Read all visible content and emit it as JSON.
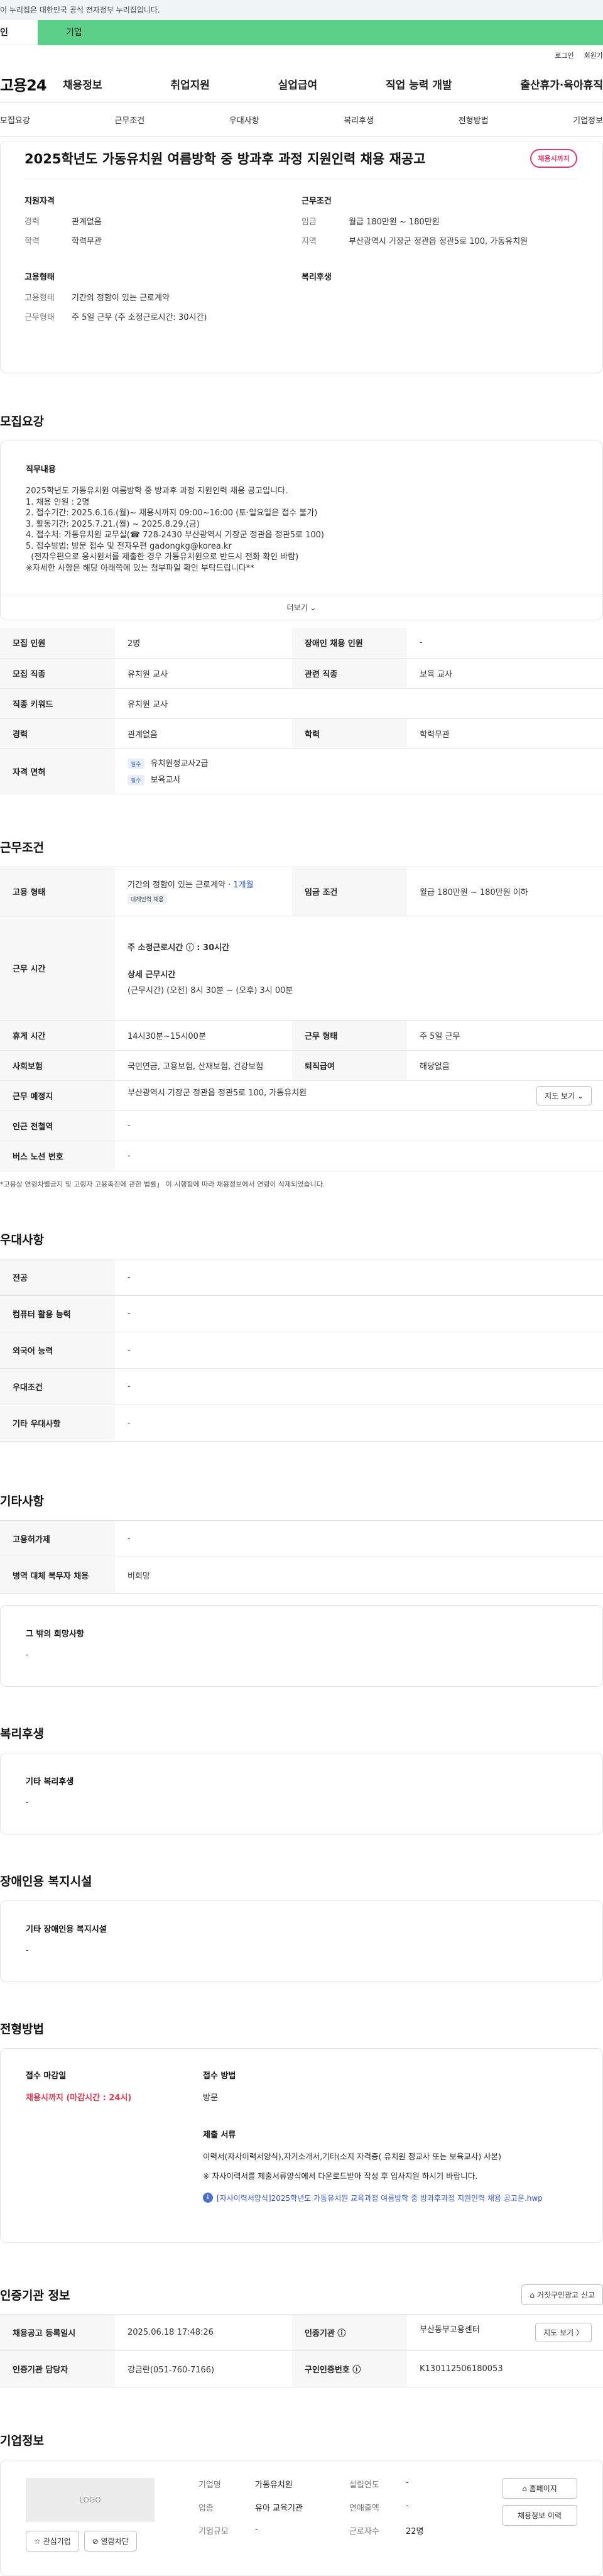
{
  "notice": {
    "text": "이 누리집은 대한민국 공식 전자정부 누리집입니다."
  },
  "member": {
    "personal": "인",
    "company": "기업"
  },
  "util": {
    "login": "로그인",
    "join": "회원가"
  },
  "gnb": {
    "logo": "고용24",
    "menu": [
      "채용정보",
      "취업지원",
      "실업급여",
      "직업 능력 개발",
      "출산휴가·육아휴직"
    ]
  },
  "tabs": [
    "모집요강",
    "근무조건",
    "우대사항",
    "복리후생",
    "전형방법",
    "기업정보"
  ],
  "summary": {
    "title": "2025학년도 가동유치원 여름방학 중 방과후 과정 지원인력 채용 재공고",
    "badge": "채용시까지",
    "qual_h": "지원자격",
    "cond_h": "근무조건",
    "emp_h": "고용형태",
    "welfare_h": "복리후생",
    "qual": [
      {
        "k": "경력",
        "v": "관계없음"
      },
      {
        "k": "학력",
        "v": "학력무관"
      }
    ],
    "cond": [
      {
        "k": "임금",
        "v": "월급 180만원 ~ 180만원"
      },
      {
        "k": "지역",
        "v": "부산광역시 기장군 정관읍 정관5로 100, 가동유치원"
      }
    ],
    "emp": [
      {
        "k": "고용형태",
        "v": "기간의 정함이 있는 근로계약"
      },
      {
        "k": "근무형태",
        "v": "주 5일 근무 (주 소정근로시간: 30시간)"
      }
    ]
  },
  "recruit": {
    "title": "모집요강",
    "h": "직무내용",
    "body": "2025학년도 가동유치원 여름방학 중 방과후 과정 지원인력 채용 공고입니다.\n1. 채용 인원 : 2명\n2. 접수기간: 2025.6.16.(월)~ 채용시까지 09:00~16:00 (토·일요일은 접수 불가)\n3. 활동기간: 2025.7.21.(월) ~ 2025.8.29.(금)\n4. 접수처: 가동유치원 교무실(☎ 728-2430 부산광역시 기장군 정관읍 정관5로 100)\n5. 접수방법: 방문 접수 및 전자우편 gadongkg@korea.kr\n  (전자우편으로 응시원서를 제출한 경우 가동유치원으로 반드시 전화 확인 바람)\n※자세한 사항은 해당 아래쪽에 있는 첨부파일 확인 부탁드립니다**",
    "more": "더보기 ⌄",
    "rows": [
      {
        "k1": "모집 인원",
        "v1": "2명",
        "k2": "장애인 채용 인원",
        "v2": "-"
      },
      {
        "k1": "모집 직종",
        "v1": "유치원 교사",
        "k2": "관련 직종",
        "v2": "보육 교사"
      },
      {
        "k1": "직종 키워드",
        "v1": "유치원 교사"
      },
      {
        "k1": "경력",
        "v1": "관계없음",
        "k2": "학력",
        "v2": "학력무관"
      }
    ],
    "license_k": "자격 면허",
    "licenses": [
      {
        "tag": "필수",
        "name": "유치원정교사2급"
      },
      {
        "tag": "필수",
        "name": "보육교사"
      }
    ]
  },
  "work": {
    "title": "근무조건",
    "emp_k": "고용 형태",
    "emp_v": "기간의 정함이 있는 근로계약 · ",
    "emp_period": "1개월",
    "emp_tag": "대체인력 채용",
    "wage_k": "임금 조건",
    "wage_v": "월급 180만원 ~ 180만원 이하",
    "time_k": "근무 시간",
    "time_week": "주 소정근로시간 ⓘ : 30시간",
    "time_detail_h": "상세 근무시간",
    "time_detail": "(근무시간) (오전) 8시 30분 ~ (오후) 3시 00분",
    "break_k": "휴게 시간",
    "break_v": "14시30분~15시00분",
    "form_k": "근무 형태",
    "form_v": "주 5일 근무",
    "ins_k": "사회보험",
    "ins_v": "국민연금, 고용보험, 산재보험, 건강보험",
    "sev_k": "퇴직급여",
    "sev_v": "해당없음",
    "place_k": "근무 예정지",
    "place_v": "부산광역시 기장군 정관읍 정관5로 100, 가동유치원",
    "map_btn": "지도 보기 ⌄",
    "station_k": "인근 전철역",
    "station_v": "-",
    "bus_k": "버스 노선 번호",
    "bus_v": "-",
    "note": "*고용상 연령차별금지 및 고령자 고용촉진에 관한 법률」 이 시행함에 따라 채용정보에서 연령이 삭제되었습니다."
  },
  "pref": {
    "title": "우대사항",
    "rows": [
      {
        "k": "전공",
        "v": "-"
      },
      {
        "k": "컴퓨터 활용 능력",
        "v": "-"
      },
      {
        "k": "외국어 능력",
        "v": "-"
      },
      {
        "k": "우대조건",
        "v": "-"
      },
      {
        "k": "기타 우대사항",
        "v": "-"
      }
    ]
  },
  "etc": {
    "title": "기타사항",
    "rows": [
      {
        "k": "고용허가제",
        "v": "-"
      },
      {
        "k": "병역 대체 복무자 채용",
        "v": "비희망"
      }
    ],
    "other_h": "그 밖의 희망사항",
    "other_v": "-"
  },
  "welfare": {
    "title": "복리후생",
    "h": "기타 복리후생",
    "v": "-"
  },
  "disabled": {
    "title": "장애인용 복지시설",
    "h": "기타 장애인용 복지시설",
    "v": "-"
  },
  "process": {
    "title": "전형방법",
    "deadline_h": "접수 마감일",
    "deadline_v": "채용시까지 (마감시간 : 24시)",
    "method_h": "접수 방법",
    "method_v": "방문",
    "docs_h": "제출 서류",
    "docs_v": "이력서(자사이력서양식),자기소개서,기타(소지 자격증( 유치원 정교사 또는 보육교사) 사본)",
    "docs_note": "※ 자사이력서를 제출서류양식에서 다운로드받아 작성 후 입사지원 하시기 바랍니다.",
    "docs_link": "[자사이력서양식]2025학년도 가동유치원 교육과정 여름방학 중 방과후과정 지원인력 채용 공고문.hwp"
  },
  "agency": {
    "title": "인증기관 정보",
    "report_btn": "거짓구인광고 신고",
    "reg_k": "채용공고 등록일시",
    "reg_v": "2025.06.18 17:48:26",
    "org_k": "인증기관 ⓘ",
    "org_v": "부산동부고용센터",
    "map_btn": "지도 보기 〉",
    "mgr_k": "인증기관 담당자",
    "mgr_v": "강금란(051-760-7166)",
    "no_k": "구인인증번호 ⓘ",
    "no_v": "K130112506180053"
  },
  "company": {
    "title": "기업정보",
    "logo": "LOGO",
    "fav": "관심기업",
    "block": "열람차단",
    "rows": [
      {
        "k1": "기업명",
        "v1": "가동유치원",
        "k2": "설립연도",
        "v2": "-"
      },
      {
        "k1": "업종",
        "v1": "유아 교육기관",
        "k2": "연매출액",
        "v2": "-"
      },
      {
        "k1": "기업규모",
        "v1": "-",
        "k2": "근로자수",
        "v2": "22명"
      }
    ],
    "home_btn": "홈페이지",
    "jobs_btn": "채용정보 이력"
  }
}
